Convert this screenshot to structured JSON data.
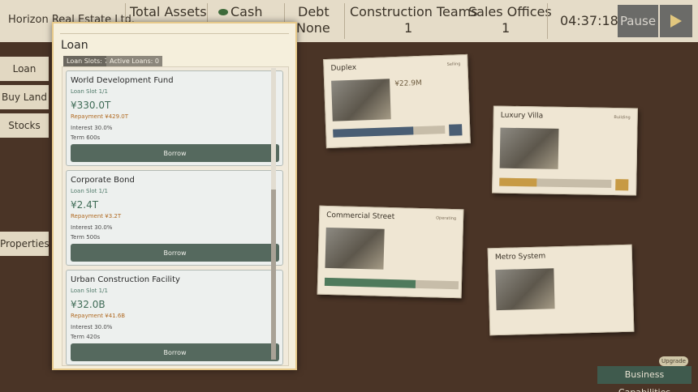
{
  "topbar": {
    "company_name": "Horizon Real Estate Ltd.",
    "stats": [
      {
        "label": "Total Assets",
        "value": ""
      },
      {
        "label": "Cash",
        "value": ""
      },
      {
        "label": "Debt",
        "value": "None"
      },
      {
        "label": "Construction Teams",
        "value": "1"
      },
      {
        "label": "Sales Offices",
        "value": "1"
      }
    ],
    "cash_icon": "money-icon",
    "clock": "04:37:18",
    "pause_label": "Pause",
    "play_icon": "play-icon"
  },
  "side_tabs": [
    "Loan",
    "Buy Land",
    "Stocks",
    "Properties"
  ],
  "cards": [
    {
      "title": "Duplex",
      "tag": "Selling",
      "value": "¥22.9M",
      "progress": 0.72
    },
    {
      "title": "Luxury Villa",
      "tag": "Building",
      "value": "",
      "progress": 0.33
    },
    {
      "title": "Commercial Street",
      "tag": "Operating",
      "value": "",
      "progress": 0.68
    },
    {
      "title": "Metro System",
      "tag": "",
      "value": "",
      "progress": 0
    }
  ],
  "loan_modal": {
    "title": "Loan",
    "slots_chip": "Loan Slots: 7",
    "active_chip": "Active Loans: 0",
    "loans": [
      {
        "name": "World Development Fund",
        "slot": "Loan Slot 1/1",
        "amount": "¥330.0T",
        "repayment": "Repayment ¥429.0T",
        "interest": "Interest 30.0%",
        "term": "Term 600s",
        "button": "Borrow"
      },
      {
        "name": "Corporate Bond",
        "slot": "Loan Slot 1/1",
        "amount": "¥2.4T",
        "repayment": "Repayment ¥3.2T",
        "interest": "Interest 30.0%",
        "term": "Term 500s",
        "button": "Borrow"
      },
      {
        "name": "Urban Construction Facility",
        "slot": "Loan Slot 1/1",
        "amount": "¥32.0B",
        "repayment": "Repayment ¥41.6B",
        "interest": "Interest 30.0%",
        "term": "Term 420s",
        "button": "Borrow"
      }
    ]
  },
  "business": {
    "label": "Business Capabilities",
    "badge": "Upgrade"
  },
  "colors": {
    "accent": "#55695e",
    "amount": "#3f6b56",
    "repayment": "#b06a22",
    "background": "#4a3426"
  }
}
